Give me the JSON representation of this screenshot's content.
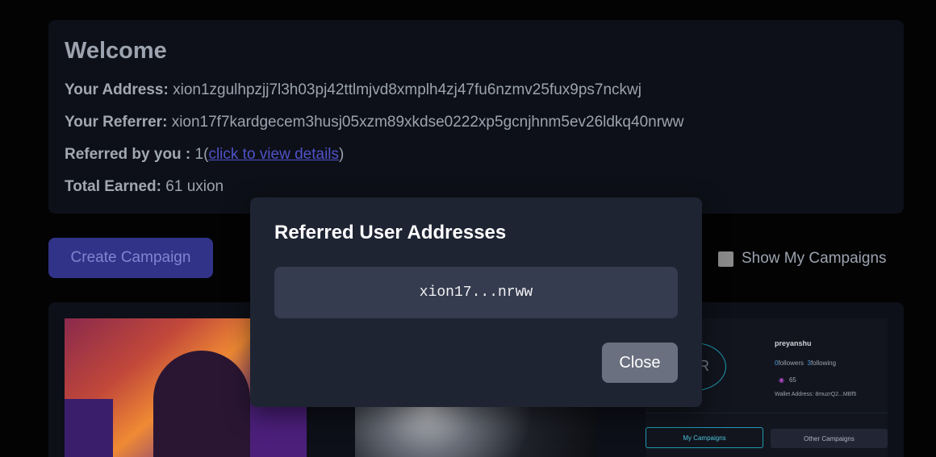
{
  "welcome": {
    "title": "Welcome",
    "address_label": "Your Address:",
    "address_value": "xion1zgulhpzjj7l3h03pj42ttlmjvd8xmplh4zj47fu6nzmv25fux9ps7nckwj",
    "referrer_label": "Your Referrer:",
    "referrer_value": "xion17f7kardgecem3husj05xzm89xkdse0222xp5gcnjhnm5ev26ldkq40nrww",
    "referred_label": "Referred by you :",
    "referred_count_prefix": "1(",
    "referred_link": "click to view details",
    "referred_suffix": ")",
    "earned_label": "Total Earned:",
    "earned_value": "61 uxion"
  },
  "toolbar": {
    "create_label": "Create Campaign",
    "show_my_label": "Show My Campaigns",
    "show_my_checked": false
  },
  "campaign_preview": {
    "profile_name": "preyanshu",
    "followers_count": "0",
    "followers_label": "followers",
    "following_count": "3",
    "following_label": "following",
    "coin_value": "65",
    "wallet_text": "Wallet Address: 8muzrQ2...MBf5",
    "avatar_letter": "R",
    "tab_my": "My Campaigns",
    "tab_other": "Other Campaigns"
  },
  "modal": {
    "title": "Referred User Addresses",
    "addresses": [
      "xion17...nrww"
    ],
    "close_label": "Close"
  }
}
